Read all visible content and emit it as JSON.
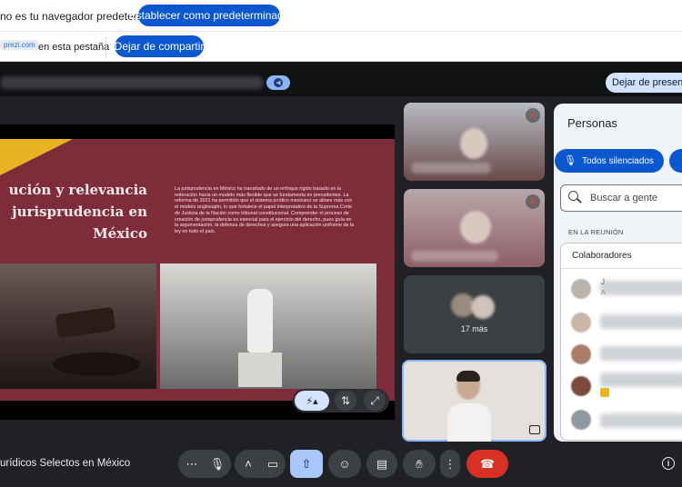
{
  "infobar1": {
    "message": "no es tu navegador predeterminado",
    "button": "Establecer como predeterminado"
  },
  "infobar2": {
    "domain": "prezi.com",
    "text": "en esta pestaña",
    "button": "Dejar de compartir"
  },
  "topbar": {
    "stop_presenting": "Dejar de presentar"
  },
  "slide": {
    "title_lines": [
      "ución y relevancia",
      "jurisprudencia en",
      "México"
    ],
    "body": "La jurisprudencia en México ha transitado de un enfoque rígido basado en la reiteración hacia un modelo más flexible que se fundamenta en precedentes. La reforma de 2021 ha permitido que el sistema jurídico mexicano se alinee más con el modelo anglosajón, lo que fortalece el papel interpretativo de la Suprema Corte de Justicia de la Nación como tribunal constitucional. Comprender el proceso de creación de jurisprudencia es esencial para el ejercicio del derecho, pues guía en la argumentación, la defensa de derechos y asegura una aplicación uniforme de la ley en todo el país."
  },
  "tiles": {
    "more_label": "17 más"
  },
  "people_panel": {
    "title": "Personas",
    "muted_all": "Todos silenciados",
    "search_placeholder": "Buscar a gente",
    "section_label": "EN LA REUNIÓN",
    "group_label": "Colaboradores",
    "row_letters": [
      "J",
      "A"
    ]
  },
  "bottombar": {
    "meeting_name": "urídicos Selectos en México"
  },
  "colors": {
    "accent_blue": "#0b57d0",
    "slide_red": "#7e2c3a",
    "end_call_red": "#d93025"
  }
}
